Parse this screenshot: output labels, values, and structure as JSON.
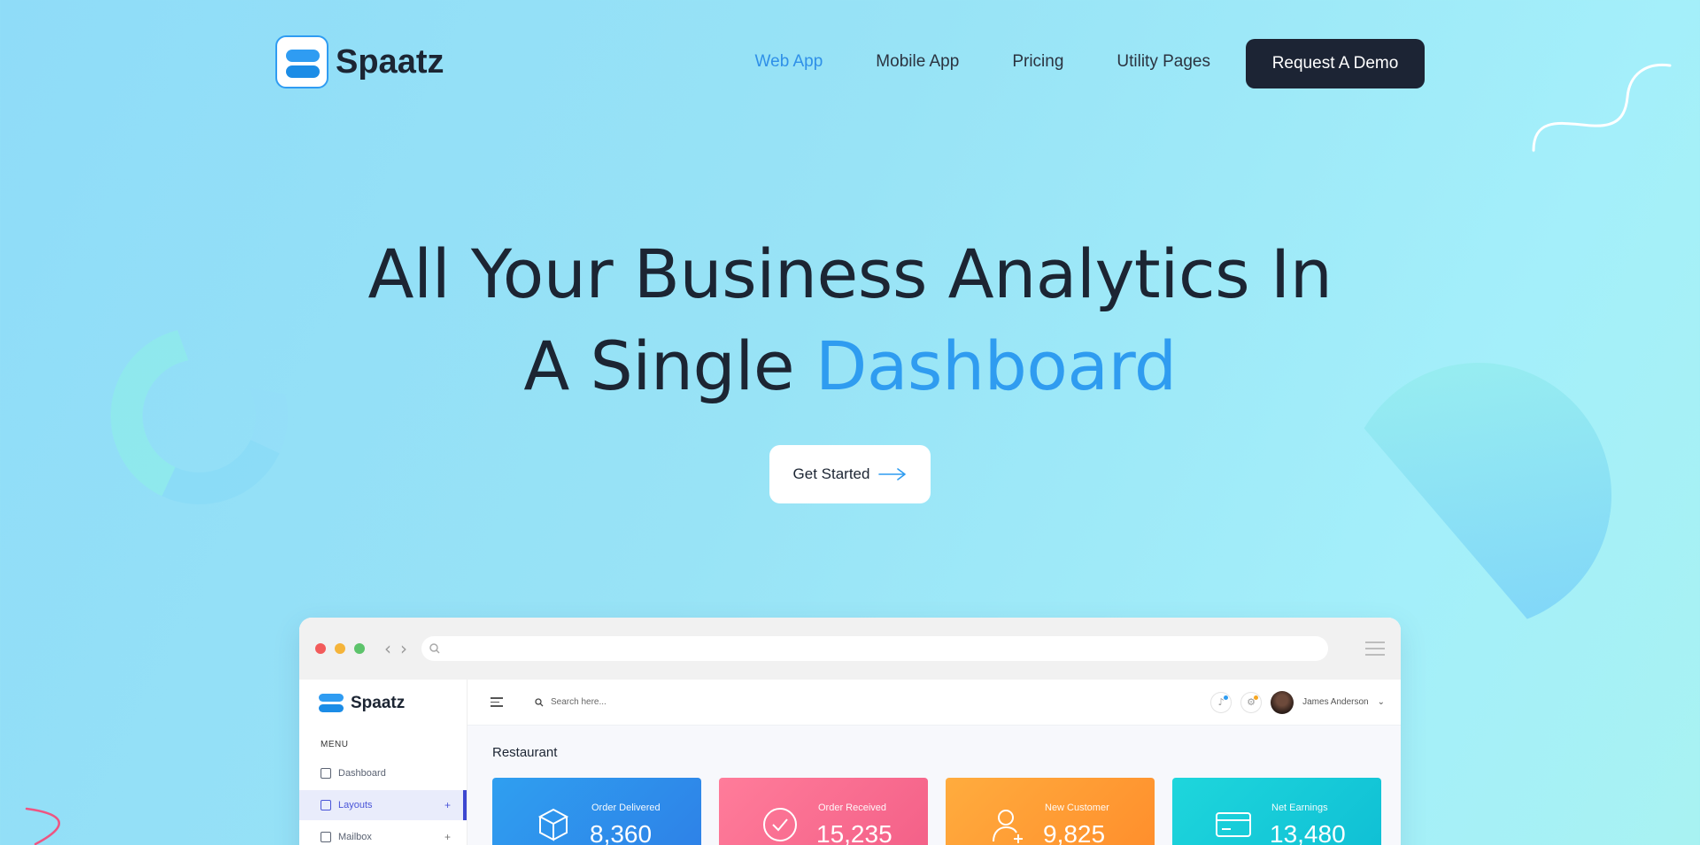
{
  "brand": {
    "name": "Spaatz"
  },
  "nav": {
    "items": [
      {
        "label": "Web App",
        "active": true
      },
      {
        "label": "Mobile App",
        "active": false
      },
      {
        "label": "Pricing",
        "active": false
      },
      {
        "label": "Utility Pages",
        "active": false
      }
    ],
    "cta_label": "Request A Demo"
  },
  "hero": {
    "title_line1": "All Your Business Analytics In",
    "title_line2_prefix": "A Single",
    "title_line2_accent": "Dashboard",
    "button_label": "Get Started"
  },
  "dashboard": {
    "brand": "Spaatz",
    "menu_heading": "MENU",
    "sidebar": [
      {
        "label": "Dashboard",
        "active": false,
        "expandable": false
      },
      {
        "label": "Layouts",
        "active": true,
        "expandable": true
      },
      {
        "label": "Mailbox",
        "active": false,
        "expandable": true
      }
    ],
    "search_placeholder": "Search here...",
    "user_name": "James Anderson",
    "section_title": "Restaurant",
    "stats": [
      {
        "label": "Order Delivered",
        "value": "8,360",
        "icon": "box-icon"
      },
      {
        "label": "Order Received",
        "value": "15,235",
        "icon": "check-circle-icon"
      },
      {
        "label": "New Customer",
        "value": "9,825",
        "icon": "user-add-icon"
      },
      {
        "label": "Net Earnings",
        "value": "13,480",
        "icon": "credit-card-icon"
      }
    ]
  },
  "colors": {
    "accent": "#2f9cf0",
    "dark": "#1c2434"
  }
}
